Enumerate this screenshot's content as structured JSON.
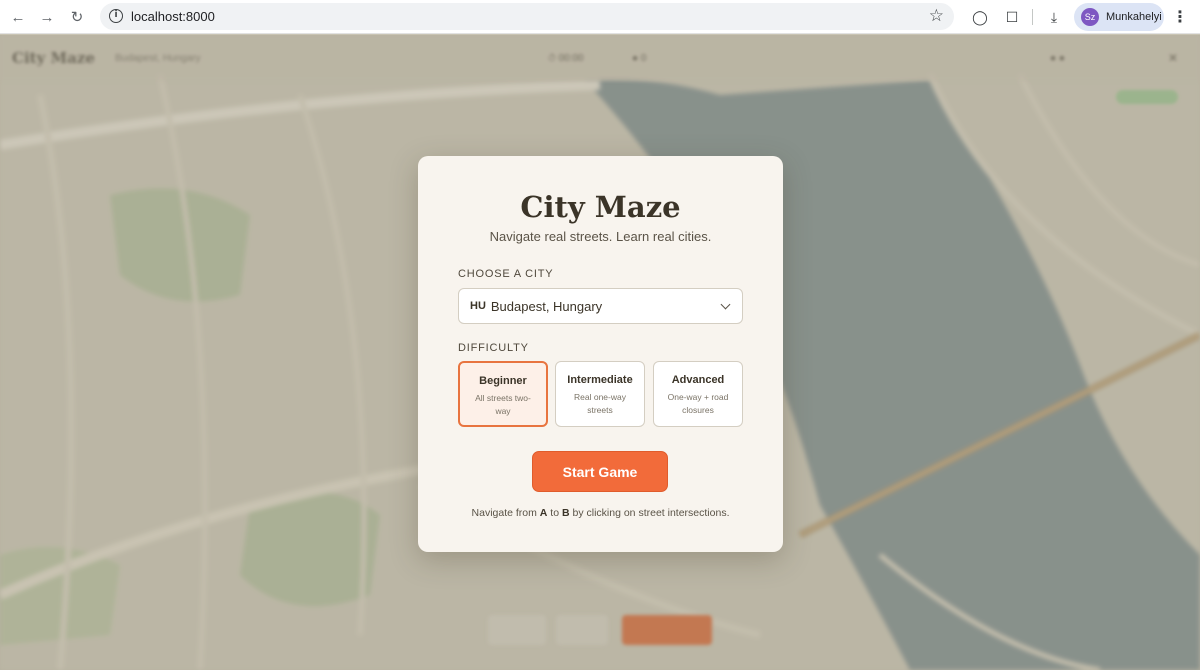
{
  "browser": {
    "url": "localhost:8000",
    "profile_initials": "Sz",
    "profile_name": "Munkahelyi",
    "icons": [
      "back-arrow-icon",
      "forward-arrow-icon",
      "reload-icon",
      "info-icon",
      "star-icon",
      "chat-icon",
      "extensions-icon",
      "download-icon",
      "kebab-menu-icon"
    ]
  },
  "modal": {
    "title": "City Maze",
    "tagline": "Navigate real streets. Learn real cities.",
    "city_label": "CHOOSE A CITY",
    "city_flag": "HU",
    "city_selected": "Budapest, Hungary",
    "difficulty_label": "DIFFICULTY",
    "difficulties": [
      {
        "name": "Beginner",
        "desc": "All streets two-way",
        "selected": true
      },
      {
        "name": "Intermediate",
        "desc": "Real one-way streets",
        "selected": false
      },
      {
        "name": "Advanced",
        "desc": "One-way + road closures",
        "selected": false
      }
    ],
    "start_label": "Start Game",
    "hint_prefix": "Navigate from ",
    "hint_a": "A",
    "hint_mid": " to ",
    "hint_b": "B",
    "hint_suffix": " by clicking on street intersections."
  },
  "colors": {
    "accent": "#f26b3a",
    "modal_bg": "#f8f4ee",
    "river": "#8e9a98",
    "map_land": "#c9c4b3"
  }
}
